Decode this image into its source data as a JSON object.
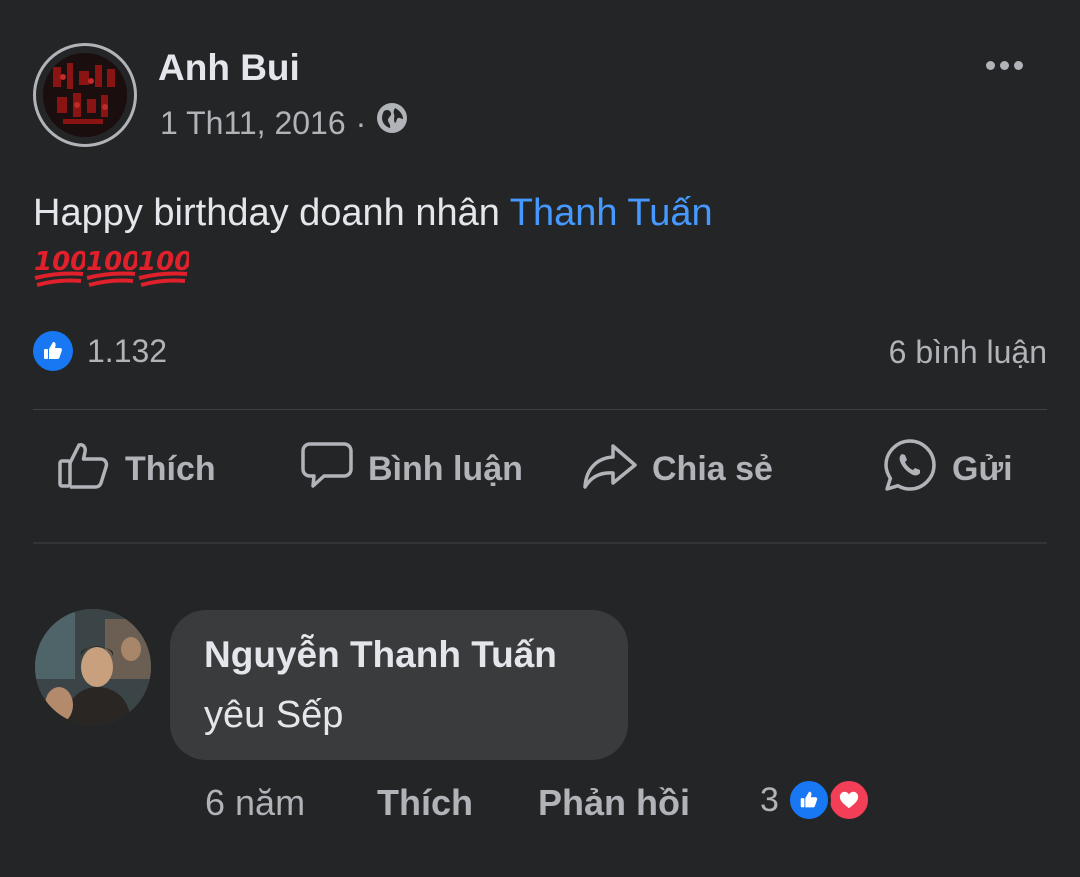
{
  "post": {
    "author": "Anh Bui",
    "date": "1 Th11, 2016",
    "separator": "·",
    "privacy_icon": "globe-icon",
    "text_prefix": "Happy birthday doanh nhân ",
    "mention": "Thanh Tuấn",
    "emoji": [
      "100",
      "100",
      "100"
    ],
    "reaction_count": "1.132",
    "comment_count": "6 bình luận"
  },
  "actions": {
    "like": "Thích",
    "comment": "Bình luận",
    "share": "Chia sẻ",
    "send": "Gửi"
  },
  "comment": {
    "author": "Nguyễn Thanh Tuấn",
    "text": "yêu Sếp",
    "age": "6 năm",
    "like": "Thích",
    "reply": "Phản hồi",
    "reaction_count": "3"
  },
  "colors": {
    "background": "#242526",
    "mention": "#4599ff",
    "like_blue": "#1877f2",
    "love_red": "#f33e58",
    "emoji_red": "#e0202b"
  }
}
